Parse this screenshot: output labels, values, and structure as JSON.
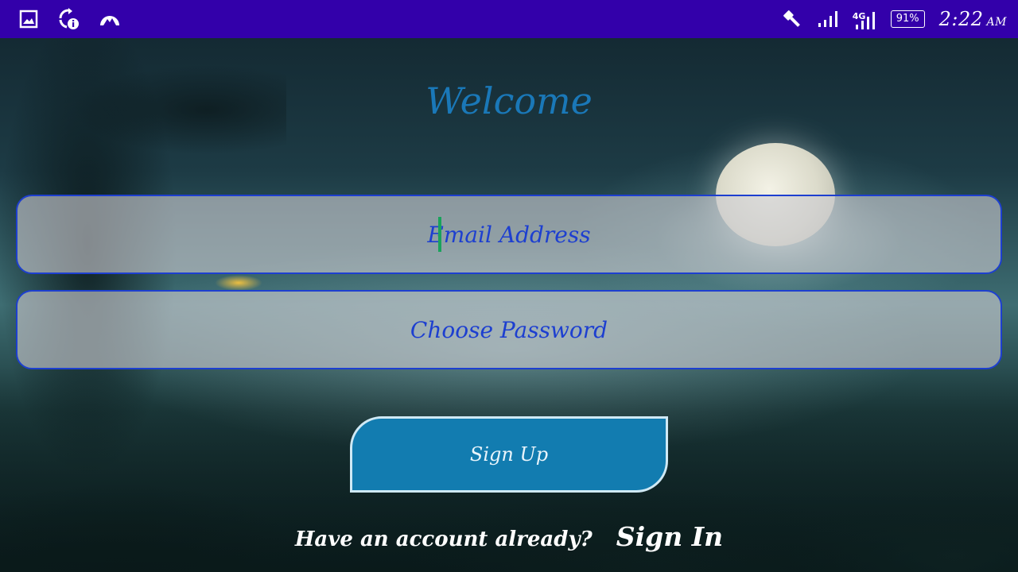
{
  "status_bar": {
    "left_icons": [
      "gallery-icon",
      "sync-info-icon",
      "vpn-mountain-icon"
    ],
    "right_icons": [
      "flashlight-icon",
      "signal-icon",
      "signal-4g-icon"
    ],
    "network_tag": "4G",
    "battery": "91%",
    "time": "2:22",
    "ampm": "AM"
  },
  "page": {
    "title": "Welcome",
    "email_placeholder": "Email Address",
    "password_placeholder": "Choose Password",
    "signup_label": "Sign Up",
    "footer_question": "Have an account already?",
    "signin_label": "Sign In"
  },
  "colors": {
    "status_bar_bg": "#3300aa",
    "title": "#1a78b8",
    "field_border": "#1d3fd0",
    "button_bg": "#127cb0",
    "caret": "#19a35c"
  }
}
